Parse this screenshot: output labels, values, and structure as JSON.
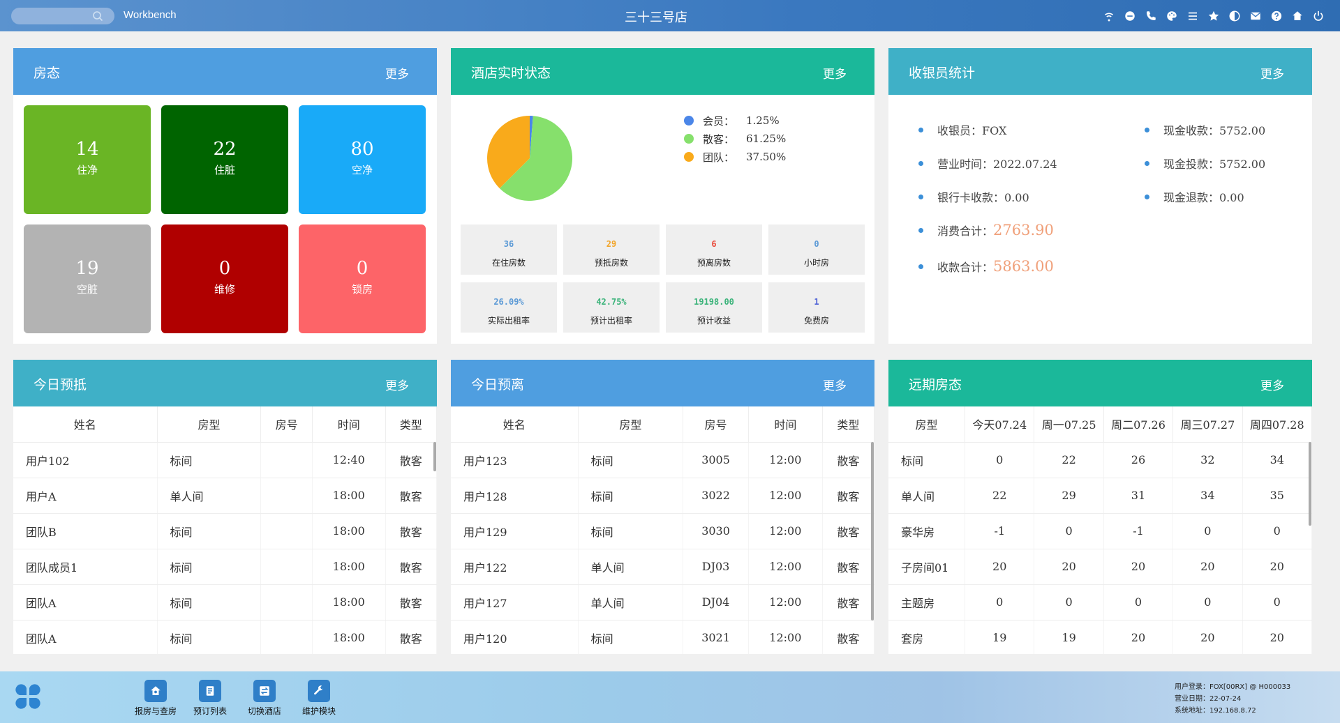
{
  "topbar": {
    "app_title": "Workbench",
    "store_title": "三十三号店",
    "icons": [
      "wifi-icon",
      "chat-icon",
      "phone-icon",
      "palette-icon",
      "menu-icon",
      "star-icon",
      "contrast-icon",
      "mail-icon",
      "help-icon",
      "home-icon",
      "power-icon"
    ]
  },
  "room_status": {
    "title": "房态",
    "more": "更多",
    "tiles": [
      {
        "count": "14",
        "label": "住净",
        "color": "#6ab525"
      },
      {
        "count": "22",
        "label": "住脏",
        "color": "#006400"
      },
      {
        "count": "80",
        "label": "空净",
        "color": "#19aaf8"
      },
      {
        "count": "19",
        "label": "空脏",
        "color": "#b3b3b3"
      },
      {
        "count": "0",
        "label": "维修",
        "color": "#b00000"
      },
      {
        "count": "0",
        "label": "锁房",
        "color": "#fd6468"
      }
    ]
  },
  "realtime": {
    "title": "酒店实时状态",
    "more": "更多",
    "chart_data": {
      "type": "pie",
      "labels": [
        "会员：",
        "散客：",
        "团队："
      ],
      "values": [
        1.25,
        61.25,
        37.5
      ],
      "value_labels": [
        "1.25%",
        "61.25%",
        "37.50%"
      ],
      "colors": [
        "#4b86e8",
        "#86e06c",
        "#f9aa1b"
      ],
      "legend": "right"
    },
    "stats": [
      {
        "value": "36",
        "label": "在住房数",
        "color": "#5c9ad6"
      },
      {
        "value": "29",
        "label": "预抵房数",
        "color": "#f2a52a"
      },
      {
        "value": "6",
        "label": "预离房数",
        "color": "#e94b3c"
      },
      {
        "value": "0",
        "label": "小时房",
        "color": "#5c9ad6"
      },
      {
        "value": "26.09%",
        "label": "实际出租率",
        "color": "#5c9ad6"
      },
      {
        "value": "42.75%",
        "label": "预计出租率",
        "color": "#3bb37a"
      },
      {
        "value": "19198.00",
        "label": "预计收益",
        "color": "#3bb37a"
      },
      {
        "value": "1",
        "label": "免费房",
        "color": "#4b5fd6"
      }
    ]
  },
  "cashier": {
    "title": "收银员统计",
    "more": "更多",
    "cashier_name": "收银员：FOX",
    "business_time": "营业时间：2022.07.24",
    "bank_card": "银行卡收款：0.00",
    "consume_label": "消费合计：",
    "consume_value": "2763.90",
    "collect_label": "收款合计：",
    "collect_value": "5863.00",
    "cash_in": "现金收款：5752.00",
    "cash_deposit": "现金投款：5752.00",
    "cash_refund": "现金退款：0.00"
  },
  "arrivals": {
    "title": "今日预抵",
    "more": "更多",
    "columns": [
      "姓名",
      "房型",
      "房号",
      "时间",
      "类型"
    ],
    "rows": [
      [
        "用户102",
        "标间",
        "",
        "12:40",
        "散客"
      ],
      [
        "用户A",
        "单人间",
        "",
        "18:00",
        "散客"
      ],
      [
        "团队B",
        "标间",
        "",
        "18:00",
        "散客"
      ],
      [
        "团队成员1",
        "标间",
        "",
        "18:00",
        "散客"
      ],
      [
        "团队A",
        "标间",
        "",
        "18:00",
        "散客"
      ],
      [
        "团队A",
        "标间",
        "",
        "18:00",
        "散客"
      ]
    ]
  },
  "departures": {
    "title": "今日预离",
    "more": "更多",
    "columns": [
      "姓名",
      "房型",
      "房号",
      "时间",
      "类型"
    ],
    "rows": [
      [
        "用户123",
        "标间",
        "3005",
        "12:00",
        "散客"
      ],
      [
        "用户128",
        "标间",
        "3022",
        "12:00",
        "散客"
      ],
      [
        "用户129",
        "标间",
        "3030",
        "12:00",
        "散客"
      ],
      [
        "用户122",
        "单人间",
        "DJ03",
        "12:00",
        "散客"
      ],
      [
        "用户127",
        "单人间",
        "DJ04",
        "12:00",
        "散客"
      ],
      [
        "用户120",
        "标间",
        "3021",
        "12:00",
        "散客"
      ]
    ]
  },
  "forecast": {
    "title": "远期房态",
    "more": "更多",
    "columns": [
      "房型",
      "今天07.24",
      "周一07.25",
      "周二07.26",
      "周三07.27",
      "周四07.28"
    ],
    "rows": [
      [
        "标间",
        "0",
        "22",
        "26",
        "32",
        "34"
      ],
      [
        "单人间",
        "22",
        "29",
        "31",
        "34",
        "35"
      ],
      [
        "豪华房",
        "-1",
        "0",
        "-1",
        "0",
        "0"
      ],
      [
        "子房间01",
        "20",
        "20",
        "20",
        "20",
        "20"
      ],
      [
        "主题房",
        "0",
        "0",
        "0",
        "0",
        "0"
      ],
      [
        "套房",
        "19",
        "19",
        "20",
        "20",
        "20"
      ]
    ]
  },
  "bottombar": {
    "buttons": [
      {
        "label": "报房与查房",
        "icon": "house-search-icon"
      },
      {
        "label": "预订列表",
        "icon": "booking-list-icon"
      },
      {
        "label": "切换酒店",
        "icon": "switch-icon"
      },
      {
        "label": "维护模块",
        "icon": "wrench-icon"
      }
    ],
    "user_login": "用户登录：FOX[00RX] @ H000033",
    "business_date": "营业日期：22-07-24",
    "system_address": "系统地址：192.168.8.72"
  }
}
